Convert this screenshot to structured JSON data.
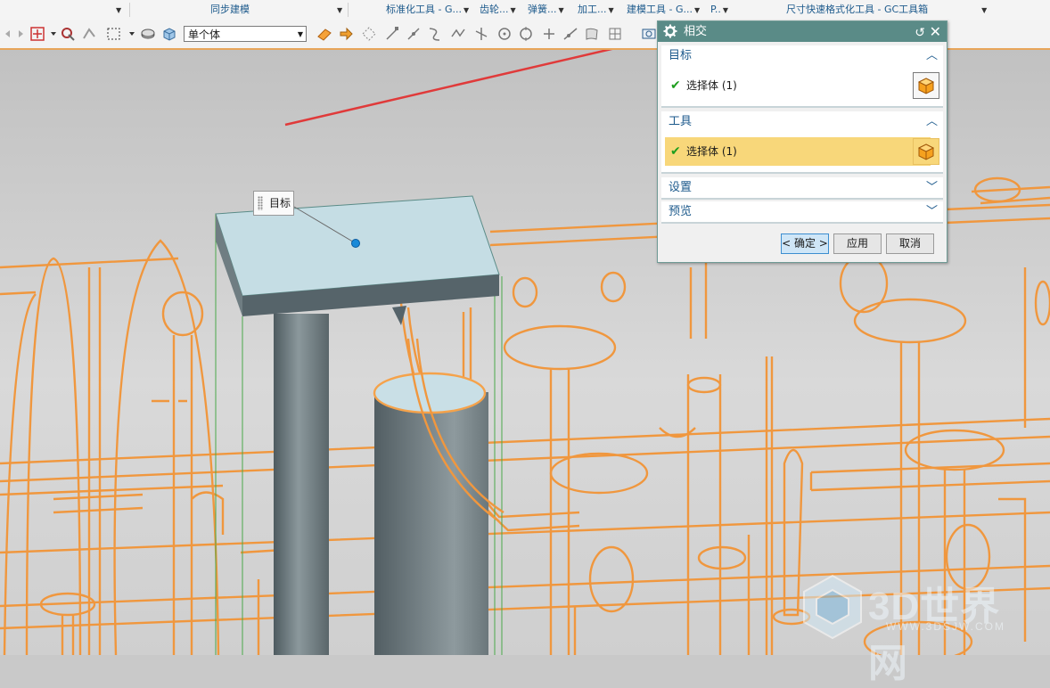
{
  "ribbon_groups": [
    {
      "label": ""
    },
    {
      "label": "同步建模"
    },
    {
      "label": "标准化工具 - G..."
    },
    {
      "label": "齿轮..."
    },
    {
      "label": "弹簧..."
    },
    {
      "label": "加工..."
    },
    {
      "label": "建模工具 - G..."
    },
    {
      "label": "P.."
    },
    {
      "label": "尺寸快速格式化工具 - GC工具箱"
    }
  ],
  "toolbar": {
    "selection_filter": "单个体"
  },
  "viewport": {
    "target_tag": "目标"
  },
  "dialog": {
    "title": "相交",
    "target_section": {
      "header": "目标",
      "row_label": "选择体 (1)"
    },
    "tool_section": {
      "header": "工具",
      "row_label": "选择体 (1)"
    },
    "settings_header": "设置",
    "preview_header": "预览",
    "ok_label": "< 确定 >",
    "apply_label": "应用",
    "cancel_label": "取消"
  },
  "watermark": {
    "text": "3D世界网",
    "sub": "WWW.3DSJW.COM"
  },
  "colors": {
    "dialog_title_bg": "#5a8b87",
    "highlight_row": "#f8d77a",
    "wireframe": "#f0973e",
    "accent_blue": "#1d5a8c"
  }
}
